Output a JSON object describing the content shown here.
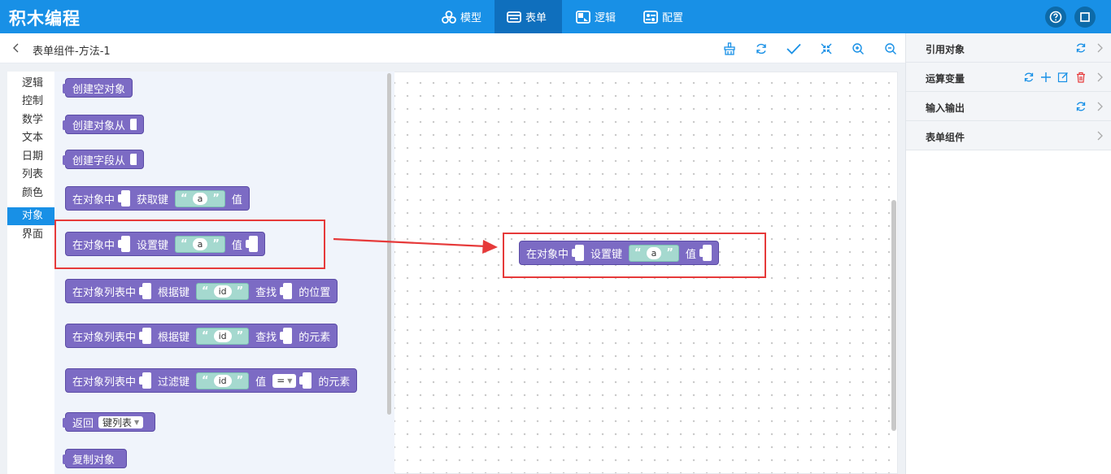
{
  "app": {
    "title": "积木编程"
  },
  "nav": {
    "tabs": [
      {
        "label": "模型",
        "icon": "model-icon"
      },
      {
        "label": "表单",
        "icon": "form-icon",
        "active": true
      },
      {
        "label": "逻辑",
        "icon": "logic-icon"
      },
      {
        "label": "配置",
        "icon": "config-icon"
      }
    ],
    "right_buttons": [
      "help-icon",
      "window-icon"
    ]
  },
  "toolbar": {
    "breadcrumb": "表单组件-方法-1",
    "icons": [
      "clean-icon",
      "refresh-icon",
      "check-icon",
      "collapse-icon",
      "zoom-in-icon",
      "zoom-out-icon"
    ]
  },
  "categories": [
    {
      "label": "逻辑"
    },
    {
      "label": "控制"
    },
    {
      "label": "数学"
    },
    {
      "label": "文本"
    },
    {
      "label": "日期"
    },
    {
      "label": "列表"
    },
    {
      "label": "颜色"
    },
    {
      "label": "对象",
      "active": true
    },
    {
      "label": "界面"
    }
  ],
  "blocks": {
    "create_empty": "创建空对象",
    "create_from": "创建对象从",
    "create_field_from": "创建字段从",
    "get_key": {
      "in_obj": "在对象中",
      "op": "获取键",
      "val": "a",
      "tail": "值"
    },
    "set_key": {
      "in_obj": "在对象中",
      "op": "设置键",
      "val": "a",
      "tail": "值"
    },
    "find_pos": {
      "in_list": "在对象列表中",
      "op": "根据键",
      "val": "id",
      "find": "查找",
      "tail": "的位置"
    },
    "find_elem": {
      "in_list": "在对象列表中",
      "op": "根据键",
      "val": "id",
      "find": "查找",
      "tail": "的元素"
    },
    "filter": {
      "in_list": "在对象列表中",
      "op": "过滤键",
      "val": "id",
      "value_lbl": "值",
      "cmp": "=",
      "tail": "的元素"
    },
    "return": {
      "label": "返回",
      "option": "键列表"
    },
    "copy": "复制对象",
    "placed": {
      "in_obj": "在对象中",
      "op": "设置键",
      "val": "a",
      "tail": "值"
    }
  },
  "quote_open": "“",
  "quote_close": "”",
  "right_panel": {
    "rows": [
      {
        "label": "引用对象"
      },
      {
        "label": "运算变量"
      },
      {
        "label": "输入输出"
      },
      {
        "label": "表单组件"
      }
    ]
  },
  "colors": {
    "topbar": "#1890e6",
    "active_tab": "#0f6fbd",
    "block": "#7c6bc4",
    "string_block": "#a5d9cf",
    "highlight": "#e63a3a"
  }
}
